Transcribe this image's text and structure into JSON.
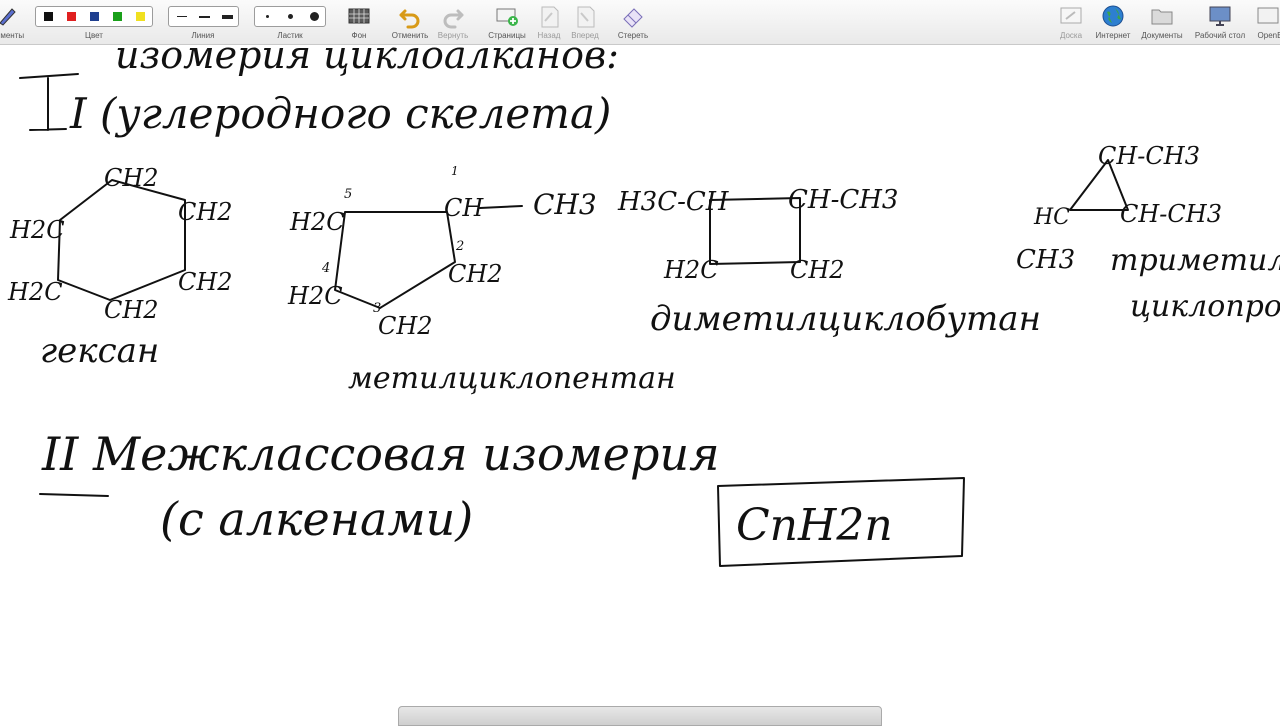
{
  "toolbar": {
    "tools_label": "ементы",
    "color_label": "Цвет",
    "line_label": "Линия",
    "eraser_label": "Ластик",
    "background_label": "Фон",
    "undo_label": "Отменить",
    "redo_label": "Вернуть",
    "pages_label": "Страницы",
    "back_label": "Назад",
    "forward_label": "Вперед",
    "erase_label": "Стереть",
    "board_label": "Доска",
    "internet_label": "Интернет",
    "documents_label": "Документы",
    "desktop_label": "Рабочий стол",
    "openboard_label": "OpenB",
    "colors": [
      "#111111",
      "#e02020",
      "#1f3f8f",
      "#1aa01a",
      "#f0e020"
    ]
  },
  "board": {
    "title": "изомерия циклоалканов:",
    "item1": "I (углеродного  скелета)",
    "mol_hexane": {
      "ch2_top": "CH2",
      "ch2_right_top": "CH2",
      "ch2_right_bottom": "CH2",
      "ch2_bottom": "CH2",
      "ch2_left_bottom": "H2C",
      "ch2_left_top": "H2C",
      "name": "гексан"
    },
    "mol_methylcyclopentane": {
      "ch": "CH",
      "ch3": "CH3",
      "ch2_right": "CH2",
      "ch2_bottom": "CH2",
      "ch2_left_bottom": "H2C",
      "ch2_left_top": "H2C",
      "num1": "1",
      "num2": "2",
      "num3": "3",
      "num4": "4",
      "num5": "5",
      "name": "метилциклопентан"
    },
    "mol_dimethylcyclobutane": {
      "left_top": "H3C-CH",
      "right_top": "CH-CH3",
      "left_bottom": "H2C",
      "right_bottom": "CH2",
      "name": "диметилциклобутан"
    },
    "mol_trimethylcyclopropane": {
      "top": "CH-CH3",
      "left": "HC",
      "left_sub": "CH3",
      "right": "CH-CH3",
      "name": "триметил-",
      "name2": "циклопроп"
    },
    "item2": "II Межклассовая изомерия",
    "item2_sub": "(с алкенами)",
    "formula": "CnH2n"
  }
}
